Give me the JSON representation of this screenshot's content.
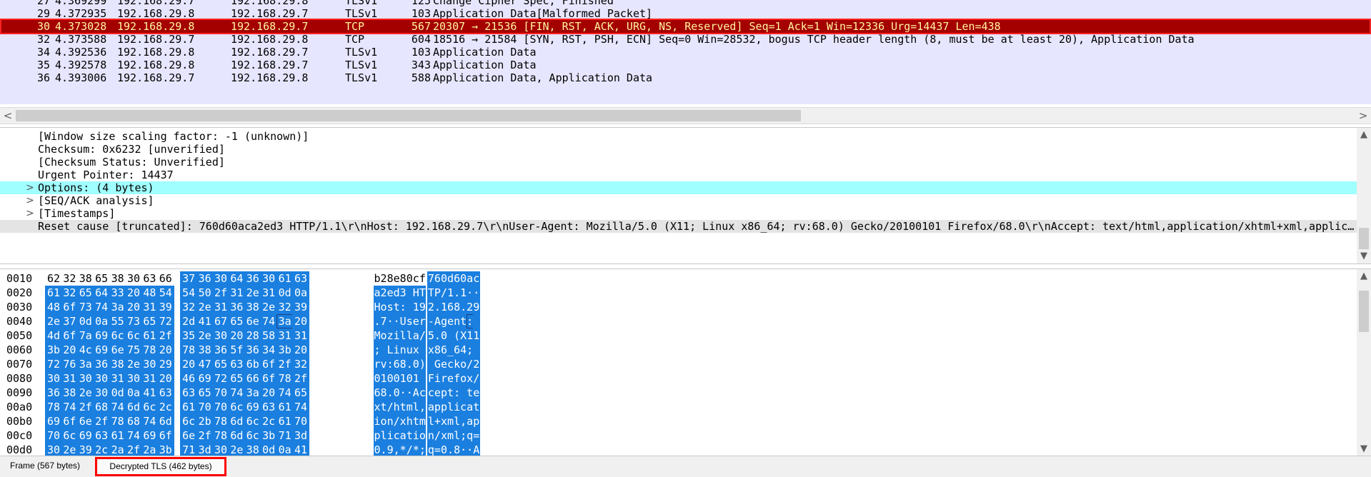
{
  "packets": [
    {
      "no": "27",
      "time": "4.369299",
      "src": "192.168.29.7",
      "dst": "192.168.29.8",
      "proto": "TLSv1",
      "len": "125",
      "info": "Change Cipher Spec, Finished",
      "selected": false
    },
    {
      "no": "29",
      "time": "4.372935",
      "src": "192.168.29.8",
      "dst": "192.168.29.7",
      "proto": "TLSv1",
      "len": "103",
      "info": "Application Data[Malformed Packet]",
      "selected": false
    },
    {
      "no": "30",
      "time": "4.373028",
      "src": "192.168.29.8",
      "dst": "192.168.29.7",
      "proto": "TCP",
      "len": "567",
      "info": "20307 → 21536 [FIN, RST, ACK, URG, NS, Reserved] Seq=1 Ack=1 Win=12336 Urg=14437 Len=438",
      "selected": true
    },
    {
      "no": "32",
      "time": "4.373588",
      "src": "192.168.29.7",
      "dst": "192.168.29.8",
      "proto": "TCP",
      "len": "604",
      "info": "18516 → 21584 [SYN, RST, PSH, ECN] Seq=0 Win=28532, bogus TCP header length (8, must be at least 20), Application Data",
      "selected": false
    },
    {
      "no": "34",
      "time": "4.392536",
      "src": "192.168.29.8",
      "dst": "192.168.29.7",
      "proto": "TLSv1",
      "len": "103",
      "info": "Application Data",
      "selected": false
    },
    {
      "no": "35",
      "time": "4.392578",
      "src": "192.168.29.8",
      "dst": "192.168.29.7",
      "proto": "TLSv1",
      "len": "343",
      "info": "Application Data",
      "selected": false
    },
    {
      "no": "36",
      "time": "4.393006",
      "src": "192.168.29.7",
      "dst": "192.168.29.8",
      "proto": "TLSv1",
      "len": "588",
      "info": "Application Data, Application Data",
      "selected": false
    }
  ],
  "hscroll": {
    "left_arrow": "<",
    "right_arrow": ">"
  },
  "details": [
    {
      "text": "[Window size scaling factor: -1 (unknown)]",
      "expander": "",
      "style": ""
    },
    {
      "text": "Checksum: 0x6232 [unverified]",
      "expander": "",
      "style": ""
    },
    {
      "text": "[Checksum Status: Unverified]",
      "expander": "",
      "style": ""
    },
    {
      "text": "Urgent Pointer: 14437",
      "expander": "",
      "style": ""
    },
    {
      "text": "Options: (4 bytes)",
      "expander": ">",
      "style": "cyan"
    },
    {
      "text": "[SEQ/ACK analysis]",
      "expander": ">",
      "style": ""
    },
    {
      "text": "[Timestamps]",
      "expander": ">",
      "style": ""
    },
    {
      "text": "Reset cause [truncated]: 760d60aca2ed3 HTTP/1.1\\r\\nHost: 192.168.29.7\\r\\nUser-Agent: Mozilla/5.0 (X11; Linux x86_64; rv:68.0) Gecko/20100101 Firefox/68.0\\r\\nAccept: text/html,application/xhtml+xml,applic…",
      "expander": "",
      "style": "gray"
    }
  ],
  "bytes": [
    {
      "offset": "0010",
      "hex": [
        "62",
        "32",
        "38",
        "65",
        "38",
        "30",
        "63",
        "66",
        "37",
        "36",
        "30",
        "64",
        "36",
        "30",
        "61",
        "63"
      ],
      "ascii": "b28e80cf760d60ac",
      "sel_start": 8
    },
    {
      "offset": "0020",
      "hex": [
        "61",
        "32",
        "65",
        "64",
        "33",
        "20",
        "48",
        "54",
        "54",
        "50",
        "2f",
        "31",
        "2e",
        "31",
        "0d",
        "0a"
      ],
      "ascii": "a2ed3 HTTP/1.1··",
      "sel_start": 0
    },
    {
      "offset": "0030",
      "hex": [
        "48",
        "6f",
        "73",
        "74",
        "3a",
        "20",
        "31",
        "39",
        "32",
        "2e",
        "31",
        "36",
        "38",
        "2e",
        "32",
        "39"
      ],
      "ascii": "Host: 192.168.29",
      "sel_start": 0
    },
    {
      "offset": "0040",
      "hex": [
        "2e",
        "37",
        "0d",
        "0a",
        "55",
        "73",
        "65",
        "72",
        "2d",
        "41",
        "67",
        "65",
        "6e",
        "74",
        "3a",
        "20"
      ],
      "ascii": ".7··User-Agent: ",
      "sel_start": 0,
      "cursor": 14
    },
    {
      "offset": "0050",
      "hex": [
        "4d",
        "6f",
        "7a",
        "69",
        "6c",
        "6c",
        "61",
        "2f",
        "35",
        "2e",
        "30",
        "20",
        "28",
        "58",
        "31",
        "31"
      ],
      "ascii": "Mozilla/5.0 (X11",
      "sel_start": 0
    },
    {
      "offset": "0060",
      "hex": [
        "3b",
        "20",
        "4c",
        "69",
        "6e",
        "75",
        "78",
        "20",
        "78",
        "38",
        "36",
        "5f",
        "36",
        "34",
        "3b",
        "20"
      ],
      "ascii": "; Linux x86_64; ",
      "sel_start": 0
    },
    {
      "offset": "0070",
      "hex": [
        "72",
        "76",
        "3a",
        "36",
        "38",
        "2e",
        "30",
        "29",
        "20",
        "47",
        "65",
        "63",
        "6b",
        "6f",
        "2f",
        "32"
      ],
      "ascii": "rv:68.0) Gecko/2",
      "sel_start": 0
    },
    {
      "offset": "0080",
      "hex": [
        "30",
        "31",
        "30",
        "30",
        "31",
        "30",
        "31",
        "20",
        "46",
        "69",
        "72",
        "65",
        "66",
        "6f",
        "78",
        "2f"
      ],
      "ascii": "0100101 Firefox/",
      "sel_start": 0
    },
    {
      "offset": "0090",
      "hex": [
        "36",
        "38",
        "2e",
        "30",
        "0d",
        "0a",
        "41",
        "63",
        "63",
        "65",
        "70",
        "74",
        "3a",
        "20",
        "74",
        "65"
      ],
      "ascii": "68.0··Accept: te",
      "sel_start": 0
    },
    {
      "offset": "00a0",
      "hex": [
        "78",
        "74",
        "2f",
        "68",
        "74",
        "6d",
        "6c",
        "2c",
        "61",
        "70",
        "70",
        "6c",
        "69",
        "63",
        "61",
        "74"
      ],
      "ascii": "xt/html,applicat",
      "sel_start": 0
    },
    {
      "offset": "00b0",
      "hex": [
        "69",
        "6f",
        "6e",
        "2f",
        "78",
        "68",
        "74",
        "6d",
        "6c",
        "2b",
        "78",
        "6d",
        "6c",
        "2c",
        "61",
        "70"
      ],
      "ascii": "ion/xhtml+xml,ap",
      "sel_start": 0
    },
    {
      "offset": "00c0",
      "hex": [
        "70",
        "6c",
        "69",
        "63",
        "61",
        "74",
        "69",
        "6f",
        "6e",
        "2f",
        "78",
        "6d",
        "6c",
        "3b",
        "71",
        "3d"
      ],
      "ascii": "plication/xml;q=",
      "sel_start": 0
    },
    {
      "offset": "00d0",
      "hex": [
        "30",
        "2e",
        "39",
        "2c",
        "2a",
        "2f",
        "2a",
        "3b",
        "71",
        "3d",
        "30",
        "2e",
        "38",
        "0d",
        "0a",
        "41"
      ],
      "ascii": "0.9,*/*;q=0.8··A",
      "sel_start": 0
    }
  ],
  "tabs": {
    "frame": "Frame (567 bytes)",
    "tls": "Decrypted TLS (462 bytes)"
  },
  "colors": {
    "list_bg": "#e7e6ff",
    "selected_bg": "#a40000",
    "selected_fg": "#fff5a0",
    "cyan": "#a0ffff",
    "byte_sel": "#1a7fdf"
  }
}
